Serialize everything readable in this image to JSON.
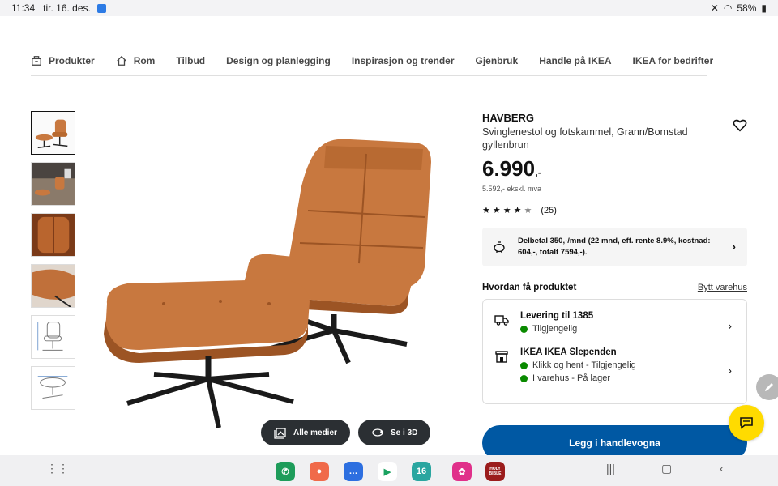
{
  "status_bar": {
    "time": "11:34",
    "date": "tir. 16. des.",
    "battery": "58%"
  },
  "nav": {
    "items": [
      "Produkter",
      "Rom",
      "Tilbud",
      "Design og planlegging",
      "Inspirasjon og trender",
      "Gjenbruk",
      "Handle på IKEA",
      "IKEA for bedrifter"
    ]
  },
  "gallery": {
    "all_media_label": "Alle medier",
    "view_3d_label": "Se i 3D"
  },
  "product": {
    "name": "HAVBERG",
    "description": "Svinglenestol og fotskammel, Grann/Bomstad gyllenbrun",
    "price": "6.990",
    "price_suffix": ",-",
    "price_ex_vat": "5.592,- ekskl. mva",
    "rating_count": "(25)",
    "rating_value": 4.5
  },
  "finance": {
    "text": "Delbetal 350,-/mnd (22 mnd, eff. rente 8.9%, kostnad: 604,-, totalt 7594,-)."
  },
  "availability": {
    "title": "Hvordan få produktet",
    "change_store": "Bytt varehus",
    "delivery_title": "Levering til 1385",
    "delivery_status": "Tilgjengelig",
    "store_title": "IKEA IKEA Slependen",
    "store_status_1": "Klikk og hent - Tilgjengelig",
    "store_status_2": "I varehus - På lager"
  },
  "cart_button": "Legg i handlevogna",
  "colors": {
    "ikea_blue": "#0058a3",
    "chat_yellow": "#ffdb00",
    "leather": "#c8783f",
    "available_green": "#0a8a00"
  },
  "taskbar": {
    "calendar_app_day": "16",
    "bible_app_label": "HOLY BIBLE"
  }
}
